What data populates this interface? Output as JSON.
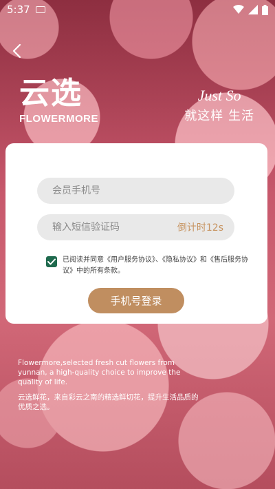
{
  "status_bar": {
    "time": "5:37",
    "icons": [
      "keyboard-icon",
      "wifi-icon",
      "signal-icon",
      "battery-icon"
    ]
  },
  "nav": {
    "back_icon": "chevron-left-icon"
  },
  "logo": {
    "cn": "云选",
    "en": "FLOWERMORE"
  },
  "slogan": {
    "en": "Just So",
    "cn": "就这样 生活"
  },
  "form": {
    "phone_placeholder": "会员手机号",
    "code_placeholder": "输入短信验证码",
    "countdown": "倒计时12s",
    "agreement_checked": true,
    "agreement_text": "已阅读并同意《用户服务协议》、《隐私协议》和《售后服务协议》中的所有条款。",
    "login_label": "手机号登录"
  },
  "footer": {
    "en": "Flowermore,selected fresh cut flowers from yunnan, a high-quality choice to improve the quality of life.",
    "cn": "云选鲜花，来自彩云之南的精选鲜切花，提升生活品质的优质之选。"
  },
  "colors": {
    "accent": "#c08e60",
    "checkbox": "#1f6a4e",
    "countdown": "#c79461"
  }
}
